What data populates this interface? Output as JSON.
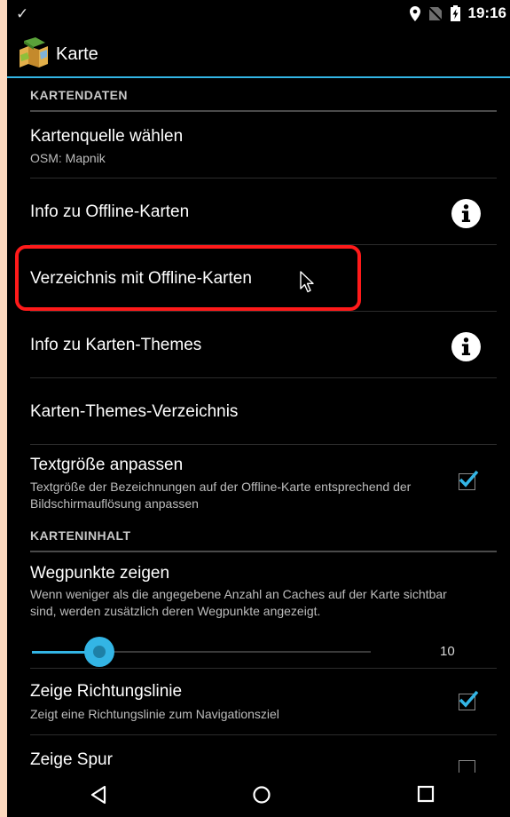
{
  "statusbar": {
    "time": "19:16"
  },
  "actionbar": {
    "title": "Karte"
  },
  "sections": {
    "map_data": "KARTENDATEN",
    "map_content": "KARTENINHALT"
  },
  "prefs": {
    "map_source": {
      "title": "Kartenquelle wählen",
      "summary": "OSM: Mapnik"
    },
    "offline_info": {
      "title": "Info zu Offline-Karten"
    },
    "offline_dir": {
      "title": "Verzeichnis mit Offline-Karten"
    },
    "themes_info": {
      "title": "Info zu Karten-Themes"
    },
    "themes_dir": {
      "title": "Karten-Themes-Verzeichnis"
    },
    "text_size": {
      "title": "Textgröße anpassen",
      "summary": "Textgröße der Bezeichnungen auf der Offline-Karte entsprechend der Bildschirmauflösung anpassen",
      "checked": true
    },
    "waypoints": {
      "title": "Wegpunkte zeigen",
      "summary": "Wenn weniger als die angegebene Anzahl an Caches auf der Karte sichtbar sind, werden zusätzlich deren Wegpunkte angezeigt.",
      "slider_value": "10",
      "slider_fraction": 0.2
    },
    "direction_line": {
      "title": "Zeige Richtungslinie",
      "summary": "Zeigt eine Richtungslinie zum Navigationsziel",
      "checked": true
    },
    "show_track": {
      "title": "Zeige Spur",
      "checked": false
    }
  },
  "colors": {
    "accent": "#33b5e5",
    "highlight": "#ff1a1a"
  }
}
